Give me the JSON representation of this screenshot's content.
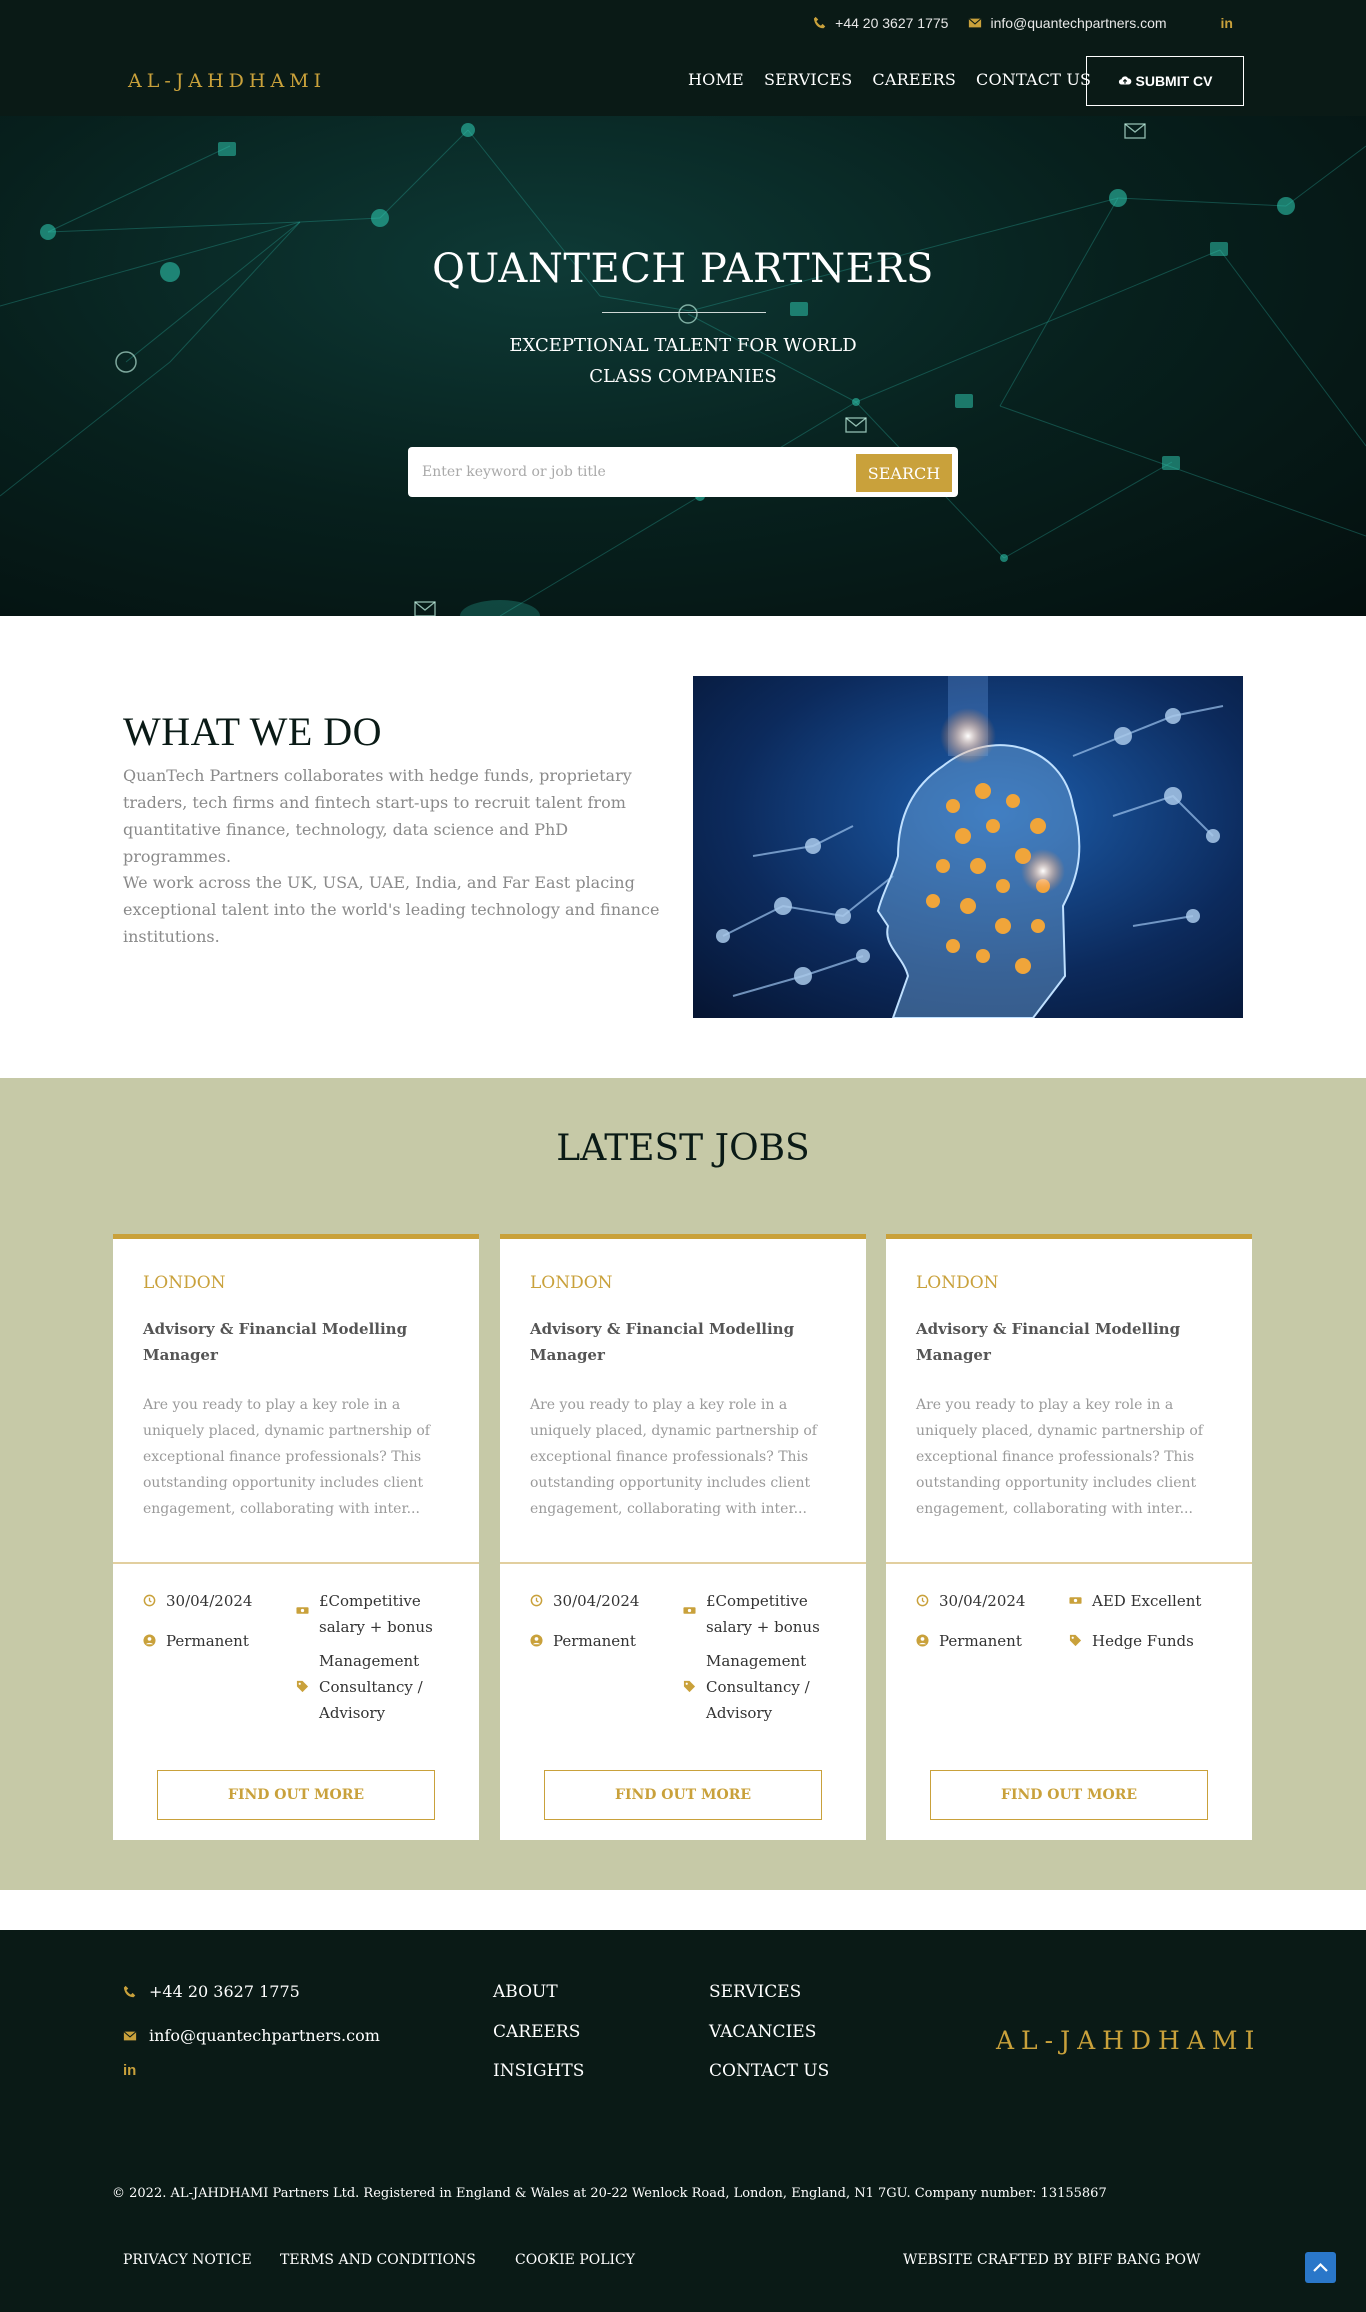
{
  "topbar": {
    "phone": "+44 20 3627 1775",
    "email": "info@quantechpartners.com",
    "linkedin": "in"
  },
  "header": {
    "logo": "AL-JAHDHAMI",
    "nav": [
      "HOME",
      "SERVICES",
      "CAREERS",
      "CONTACT US"
    ],
    "submit_cv": "SUBMIT CV"
  },
  "hero": {
    "title": "QUANTECH PARTNERS",
    "subtitle_line1": "EXCEPTIONAL TALENT FOR WORLD",
    "subtitle_line2": "CLASS COMPANIES",
    "search_placeholder": "Enter keyword or job title",
    "search_button": "SEARCH"
  },
  "what_we_do": {
    "heading": "WHAT WE DO",
    "paragraph1": "QuanTech Partners collaborates with hedge funds, proprietary traders, tech firms and fintech start-ups to recruit talent from quantitative finance, technology, data science and PhD programmes.",
    "paragraph2": "We work across the UK, USA, UAE, India, and Far East placing exceptional talent into the world's leading technology and finance institutions."
  },
  "jobs": {
    "heading": "LATEST JOBS",
    "cards": [
      {
        "location": "LONDON",
        "title": "Advisory & Financial Modelling Manager",
        "description": "Are you ready to play a key role in a uniquely placed, dynamic partnership of exceptional finance professionals?  This outstanding opportunity includes client engagement, collaborating with inter...",
        "date": "30/04/2024",
        "type": "Permanent",
        "salary": "£Competitive salary + bonus",
        "sector": "Management Consultancy / Advisory",
        "button": "FIND OUT MORE"
      },
      {
        "location": "LONDON",
        "title": "Advisory & Financial Modelling Manager",
        "description": "Are you ready to play a key role in a uniquely placed, dynamic partnership of exceptional finance professionals?  This outstanding opportunity includes client engagement, collaborating with inter...",
        "date": "30/04/2024",
        "type": "Permanent",
        "salary": "£Competitive salary + bonus",
        "sector": "Management Consultancy / Advisory",
        "button": "FIND OUT MORE"
      },
      {
        "location": "LONDON",
        "title": "Advisory & Financial Modelling Manager",
        "description": "Are you ready to play a key role in a uniquely placed, dynamic partnership of exceptional finance professionals?  This outstanding opportunity includes client engagement, collaborating with inter...",
        "date": "30/04/2024",
        "type": "Permanent",
        "salary": "AED Excellent",
        "sector": "Hedge Funds",
        "button": "FIND OUT MORE"
      }
    ]
  },
  "footer": {
    "phone": "+44 20 3627 1775",
    "email": "info@quantechpartners.com",
    "linkedin": "in",
    "links_col1": [
      "ABOUT",
      "CAREERS",
      "INSIGHTS"
    ],
    "links_col2": [
      "SERVICES",
      "VACANCIES",
      "CONTACT US"
    ],
    "logo": "AL-JAHDHAMI",
    "copyright": "© 2022. AL-JAHDHAMI Partners Ltd. Registered in England & Wales at 20-22 Wenlock Road, London, England, N1 7GU. Company number: 13155867",
    "legal": [
      "PRIVACY NOTICE",
      "TERMS AND CONDITIONS",
      "COOKIE POLICY"
    ],
    "credit": "WEBSITE CRAFTED BY BIFF BANG POW"
  },
  "colors": {
    "accent": "#c9a13b",
    "dark": "#0a1a16",
    "jobs_bg": "#c6c9a7"
  }
}
